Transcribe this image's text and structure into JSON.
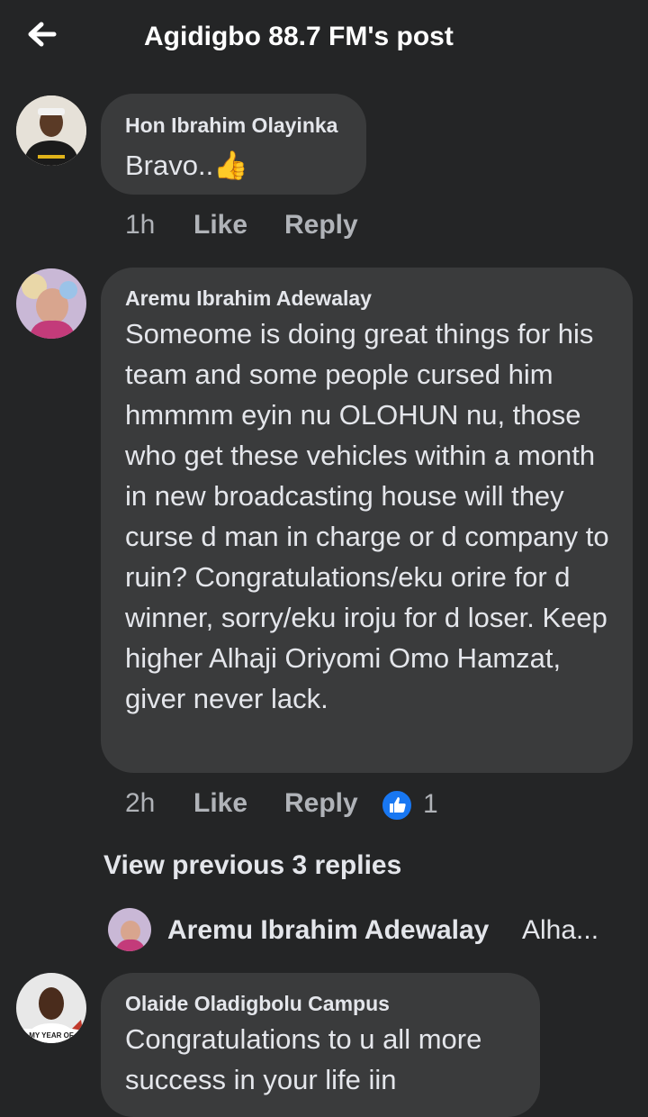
{
  "header": {
    "title": "Agidigbo 88.7 FM's post",
    "back_icon": "back-arrow-icon"
  },
  "comments": [
    {
      "author": "Hon Ibrahim Olayinka",
      "text": "Bravo..👍",
      "time": "1h",
      "like_label": "Like",
      "reply_label": "Reply"
    },
    {
      "author": "Aremu Ibrahim Adewalay",
      "text": "Someome is doing great things for his team and some people cursed him hmmmm eyin nu OLOHUN nu, those who get these vehicles within a month in new broadcasting house will they curse d man in charge or d company to ruin? Congratulations/eku orire for d winner, sorry/eku iroju for d loser. Keep higher Alhaji Oriyomi Omo Hamzat, giver never lack.",
      "time": "2h",
      "like_label": "Like",
      "reply_label": "Reply",
      "reaction_count": "1",
      "reaction_icon": "like-reaction-icon"
    },
    {
      "author": "Olaide Oladigbolu Campus",
      "text": "Congratulations to u all more success in your life iin"
    }
  ],
  "replies": {
    "view_previous": "View previous 3 replies",
    "latest_author": "Aremu Ibrahim Adewalay",
    "latest_preview": "Alha..."
  },
  "avatar_badge_text": "MY YEAR OF",
  "colors": {
    "background": "#242526",
    "bubble": "#3a3b3c",
    "text": "#e4e6eb",
    "muted": "#b0b3b8",
    "like_blue": "#1877f2"
  }
}
